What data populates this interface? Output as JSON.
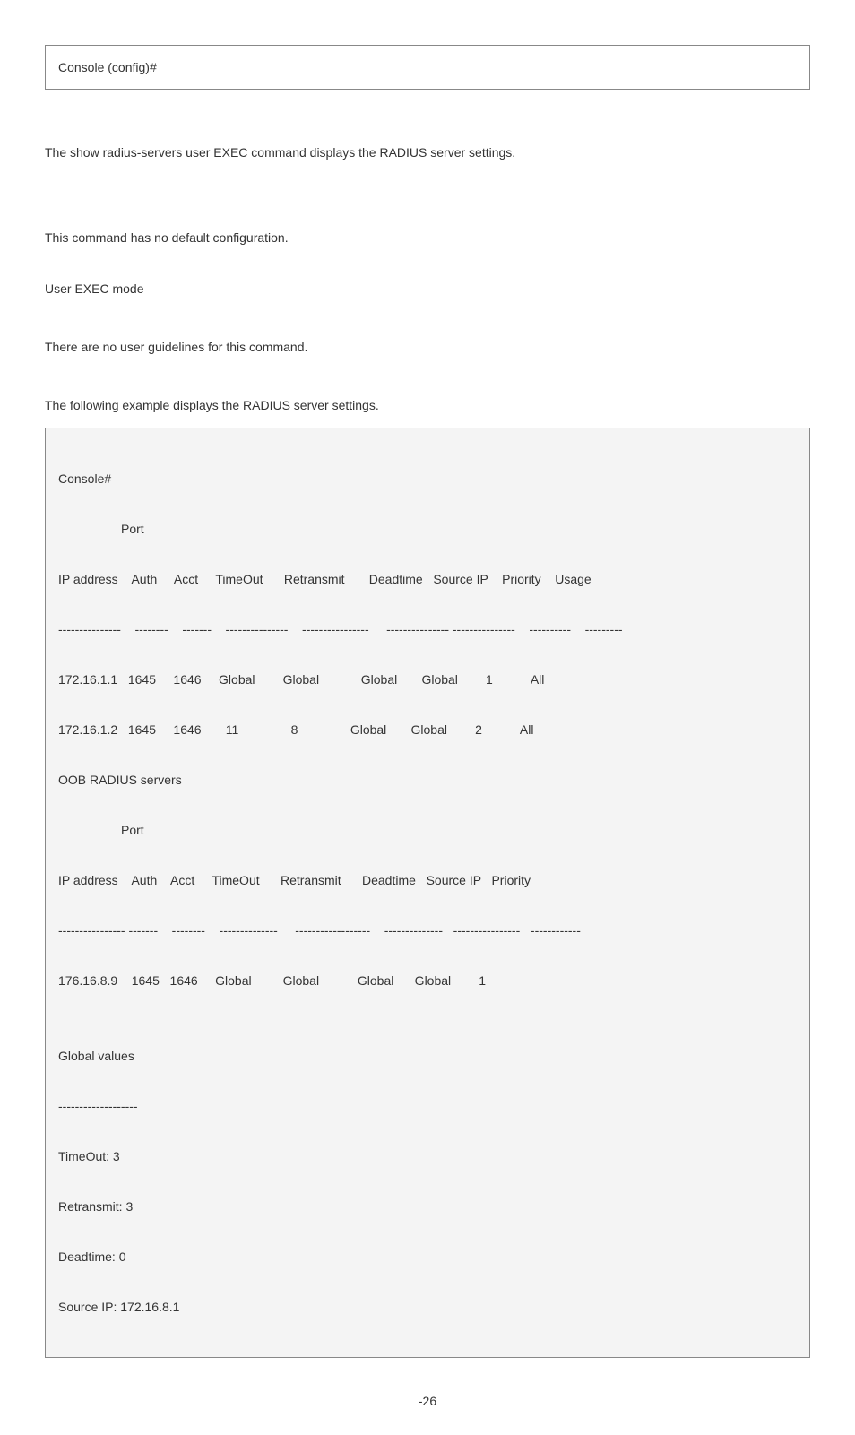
{
  "codebox": {
    "line1": "Console (config)#"
  },
  "para1": "The show radius-servers user EXEC command displays the RADIUS server settings.",
  "para2": "This command has no default configuration.",
  "para3": "User EXEC mode",
  "para4": "There are no user guidelines for this command.",
  "para5": "The following example displays the RADIUS server settings.",
  "output": {
    "l1": "Console#",
    "l2": "                  Port",
    "l3": "IP address    Auth     Acct     TimeOut      Retransmit       Deadtime   Source IP    Priority    Usage",
    "l4": "---------------    --------    -------    ---------------    ----------------     --------------- ---------------    ----------    ---------",
    "l5": "172.16.1.1   1645     1646     Global        Global            Global       Global        1           All",
    "l6": "172.16.1.2   1645     1646       11               8               Global       Global        2           All",
    "l7": "OOB RADIUS servers",
    "l8": "                  Port",
    "l9": "IP address    Auth    Acct     TimeOut      Retransmit      Deadtime   Source IP   Priority",
    "l10": "---------------- -------    --------    --------------     ------------------    --------------   ----------------   ------------",
    "l11": "176.16.8.9    1645   1646     Global         Global           Global      Global        1",
    "l12": "",
    "l13": "Global values",
    "l14": "-------------------",
    "l15": "TimeOut: 3",
    "l16": "Retransmit: 3",
    "l17": "Deadtime: 0",
    "l18": "Source IP: 172.16.8.1"
  },
  "pagenum": "-26"
}
